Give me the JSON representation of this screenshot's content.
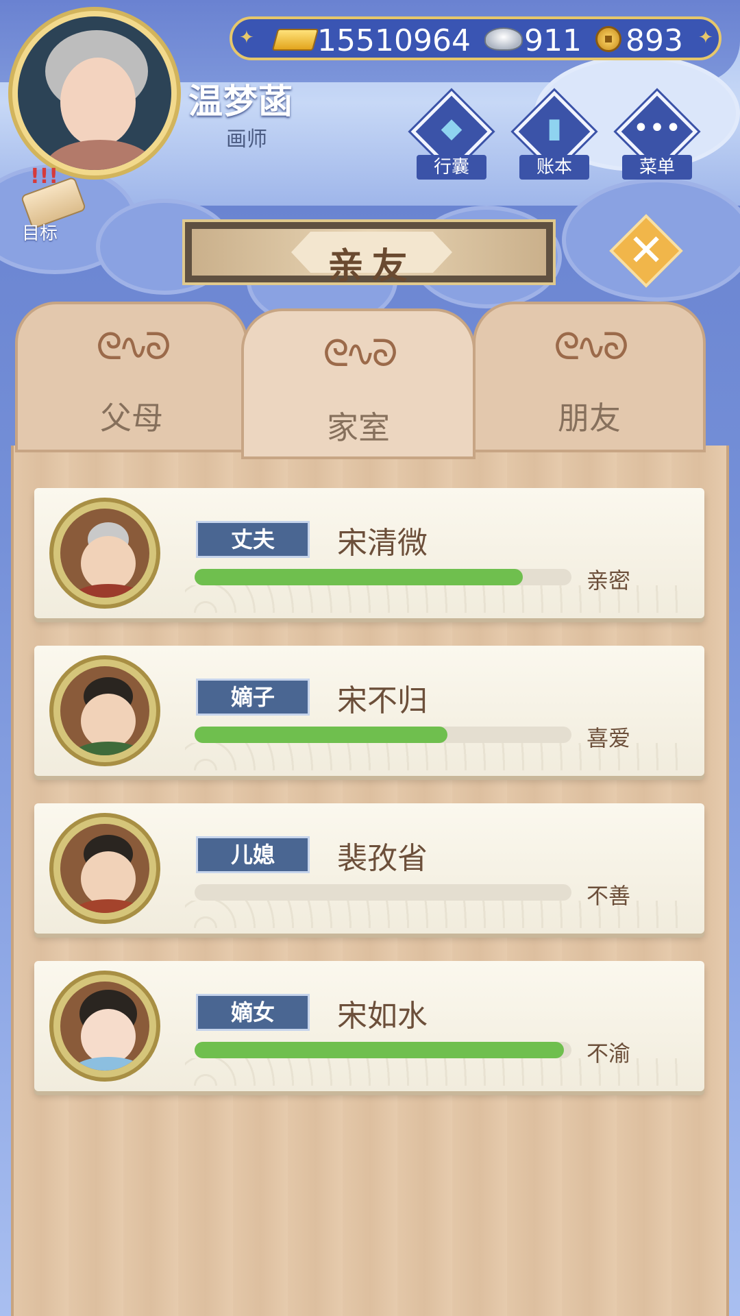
{
  "header": {
    "player_name": "温梦菡",
    "player_title": "画师",
    "currencies": {
      "gold": "15510964",
      "silver": "911",
      "coin": "893"
    },
    "menu": [
      {
        "label": "行囊",
        "icon": "bag-icon"
      },
      {
        "label": "账本",
        "icon": "ledger-icon"
      },
      {
        "label": "菜单",
        "icon": "more-icon"
      }
    ],
    "goal_label": "目标"
  },
  "panel": {
    "title": "亲友",
    "tabs": [
      {
        "label": "父母",
        "active": false
      },
      {
        "label": "家室",
        "active": true
      },
      {
        "label": "朋友",
        "active": false
      }
    ],
    "rows": [
      {
        "role": "丈夫",
        "name": "宋清微",
        "relation": "亲密",
        "affinity": 0.87
      },
      {
        "role": "嫡子",
        "name": "宋不归",
        "relation": "喜爱",
        "affinity": 0.67
      },
      {
        "role": "儿媳",
        "name": "裴孜省",
        "relation": "不善",
        "affinity": 0.0
      },
      {
        "role": "嫡女",
        "name": "宋如水",
        "relation": "不渝",
        "affinity": 0.98
      }
    ]
  },
  "colors": {
    "affinity_bar": "#6fbf4e",
    "role_tag": "#4a6692",
    "close_button": "#f1b64a"
  }
}
